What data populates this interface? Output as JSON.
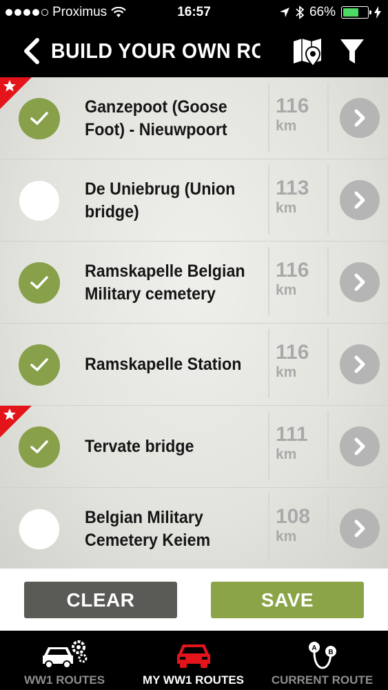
{
  "status": {
    "carrier": "Proximus",
    "time": "16:57",
    "battery": "66%",
    "battery_level": 0.66,
    "signal_bars": 4
  },
  "nav": {
    "title": "BUILD YOUR OWN RO...",
    "back_icon": "chevron-left-icon",
    "map_icon": "map-pin-icon",
    "filter_icon": "filter-icon"
  },
  "colors": {
    "accent_green": "#88a04a",
    "favorite_red": "#e4141b",
    "clear_gray": "#5a5a57",
    "active_tab_red": "#e4141b"
  },
  "items": [
    {
      "name": "Ganzepoot  (Goose Foot) - Nieuwpoort",
      "distance": "116",
      "unit": "km",
      "selected": true,
      "favorite": true
    },
    {
      "name": "De Uniebrug (Union bridge)",
      "distance": "113",
      "unit": "km",
      "selected": false,
      "favorite": false
    },
    {
      "name": "Ramskapelle Belgian Military cemetery",
      "distance": "116",
      "unit": "km",
      "selected": true,
      "favorite": false
    },
    {
      "name": "Ramskapelle Station",
      "distance": "116",
      "unit": "km",
      "selected": true,
      "favorite": false
    },
    {
      "name": "Tervate bridge",
      "distance": "111",
      "unit": "km",
      "selected": true,
      "favorite": true
    },
    {
      "name": "Belgian Military Cemetery Keiem",
      "distance": "108",
      "unit": "km",
      "selected": false,
      "favorite": false
    }
  ],
  "actions": {
    "clear": "CLEAR",
    "save": "SAVE"
  },
  "tabs": [
    {
      "label": "WW1 ROUTES",
      "icon": "car-gear-icon",
      "active": false
    },
    {
      "label": "MY WW1 ROUTES",
      "icon": "car-icon",
      "active": true
    },
    {
      "label": "CURRENT ROUTE",
      "icon": "route-ab-icon",
      "active": false
    }
  ]
}
